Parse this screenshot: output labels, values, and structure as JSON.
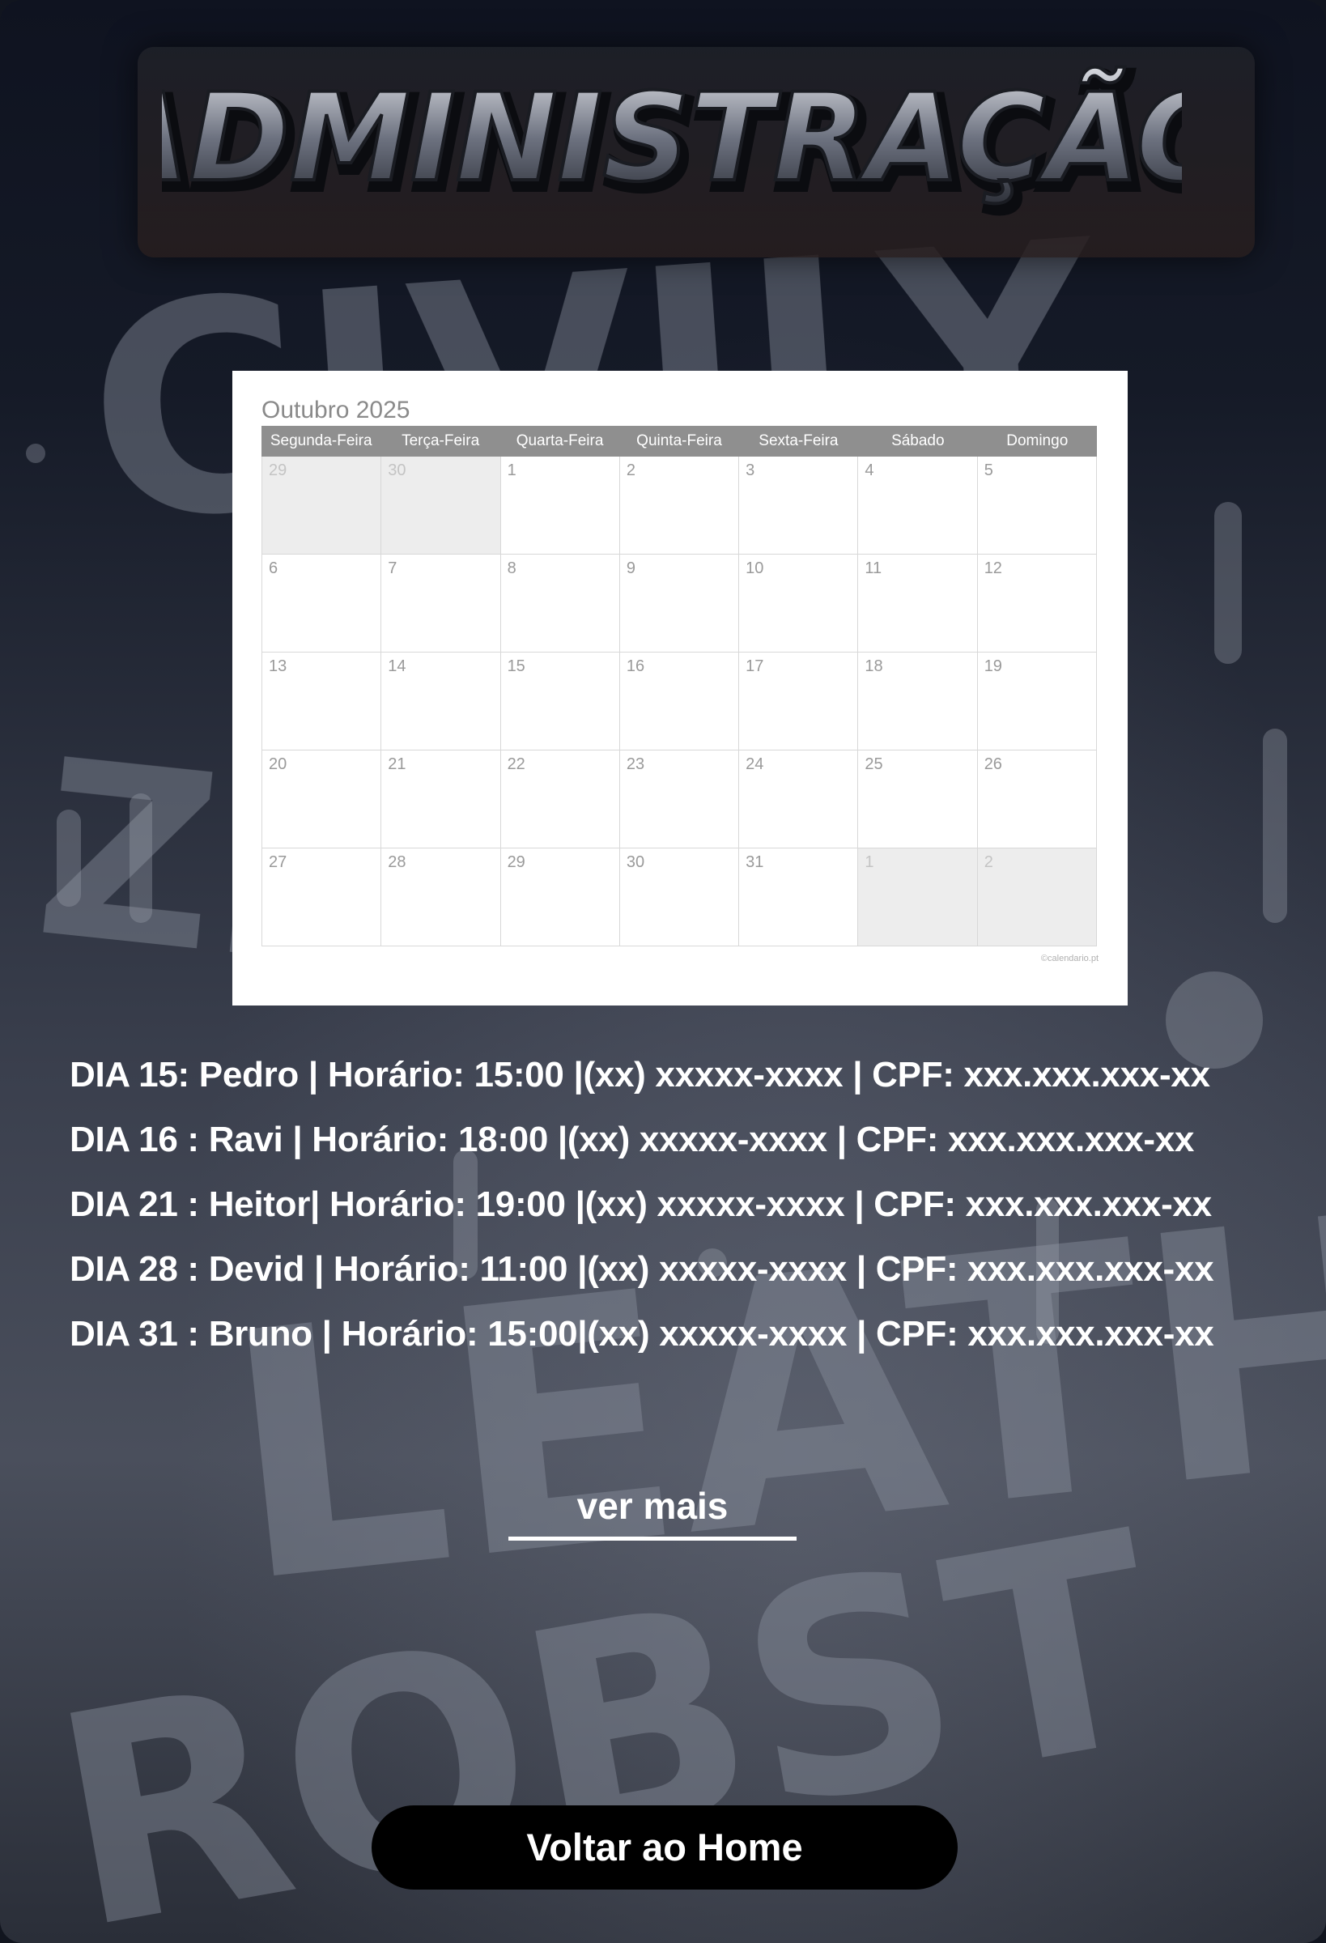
{
  "header": {
    "logo_text": "ADMINISTRAÇÃO"
  },
  "calendar": {
    "title": "Outubro 2025",
    "weekdays": [
      "Segunda-Feira",
      "Terça-Feira",
      "Quarta-Feira",
      "Quinta-Feira",
      "Sexta-Feira",
      "Sábado",
      "Domingo"
    ],
    "weeks": [
      [
        "29",
        "30",
        "1",
        "2",
        "3",
        "4",
        "5"
      ],
      [
        "6",
        "7",
        "8",
        "9",
        "10",
        "11",
        "12"
      ],
      [
        "13",
        "14",
        "15",
        "16",
        "17",
        "18",
        "19"
      ],
      [
        "20",
        "21",
        "22",
        "23",
        "24",
        "25",
        "26"
      ],
      [
        "27",
        "28",
        "29",
        "30",
        "31",
        "1",
        "2"
      ]
    ],
    "footer": "©calendario.pt"
  },
  "appointments": [
    "DIA 15: Pedro | Horário: 15:00 |(xx) xxxxx-xxxx | CPF: xxx.xxx.xxx-xx",
    "DIA 16 : Ravi    | Horário: 18:00  |(xx) xxxxx-xxxx | CPF:  xxx.xxx.xxx-xx",
    "DIA 21 : Heitor| Horário: 19:00 |(xx) xxxxx-xxxx  | CPF: xxx.xxx.xxx-xx",
    "DIA 28 : Devid | Horário: 11:00 |(xx) xxxxx-xxxx  | CPF: xxx.xxx.xxx-xx",
    "DIA 31 : Bruno | Horário: 15:00|(xx) xxxxx-xxxx  | CPF: xxx.xxx.xxx-xx"
  ],
  "actions": {
    "more_label": "ver mais",
    "home_label": "Voltar ao Home"
  },
  "colors": {
    "background": "#11151f",
    "text": "#ffffff",
    "button": "#000000"
  }
}
